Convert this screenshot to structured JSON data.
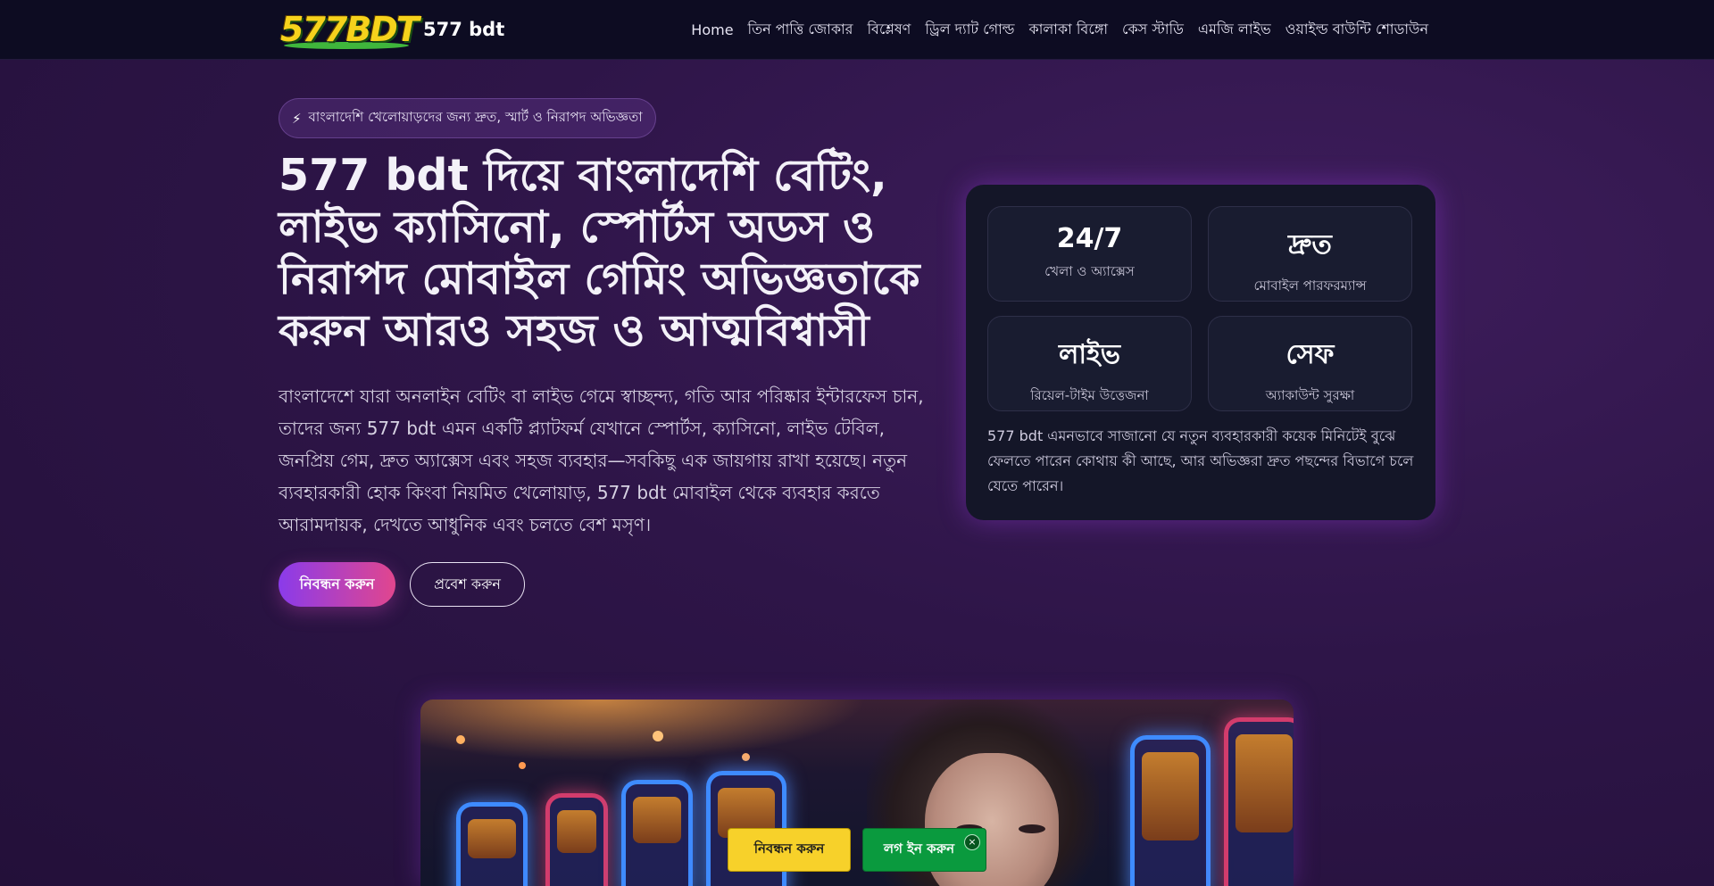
{
  "header": {
    "logo_text": "577BDT",
    "brand_name": "577 bdt",
    "nav": [
      "Home",
      "তিন পাত্তি জোকার",
      "বিশ্লেষণ",
      "ড্রিল দ্যাট গোল্ড",
      "কালাকা বিঙ্গো",
      "কেস স্টাডি",
      "এমজি লাইভ",
      "ওয়াইল্ড বাউন্টি শোডাউন"
    ]
  },
  "hero": {
    "badge_icon": "lightning-icon",
    "badge_text": "বাংলাদেশি খেলোয়াড়দের জন্য দ্রুত, স্মার্ট ও নিরাপদ অভিজ্ঞতা",
    "title": "577 bdt দিয়ে বাংলাদেশি বেটিং, লাইভ ক্যাসিনো, স্পোর্টস অডস ও নিরাপদ মোবাইল গেমিং অভিজ্ঞতাকে করুন আরও সহজ ও আত্মবিশ্বাসী",
    "description": "বাংলাদেশে যারা অনলাইন বেটিং বা লাইভ গেমে স্বাচ্ছন্দ্য, গতি আর পরিষ্কার ইন্টারফেস চান, তাদের জন্য 577 bdt এমন একটি প্ল্যাটফর্ম যেখানে স্পোর্টস, ক্যাসিনো, লাইভ টেবিল, জনপ্রিয় গেম, দ্রুত অ্যাক্সেস এবং সহজ ব্যবহার—সবকিছু এক জায়গায় রাখা হয়েছে। নতুন ব্যবহারকারী হোক কিংবা নিয়মিত খেলোয়াড়, 577 bdt মোবাইল থেকে ব্যবহার করতে আরামদায়ক, দেখতে আধুনিক এবং চলতে বেশ মসৃণ।",
    "register_label": "নিবন্ধন করুন",
    "login_label": "প্রবেশ করুন"
  },
  "stats": {
    "items": [
      {
        "value": "24/7",
        "label": "খেলা ও অ্যাক্সেস"
      },
      {
        "value": "দ্রুত",
        "label": "মোবাইল পারফরম্যান্স"
      },
      {
        "value": "লাইভ",
        "label": "রিয়েল-টাইম উত্তেজনা"
      },
      {
        "value": "সেফ",
        "label": "অ্যাকাউন্ট সুরক্ষা"
      }
    ],
    "note": "577 bdt এমনভাবে সাজানো যে নতুন ব্যবহারকারী কয়েক মিনিটেই বুঝে ফেলতে পারেন কোথায় কী আছে, আর অভিজ্ঞরা দ্রুত পছন্দের বিভাগে চলে যেতে পারেন।"
  },
  "floating_bar": {
    "register_label": "নিবন্ধন করুন",
    "login_label": "লগ ইন করুন",
    "close_symbol": "×"
  },
  "colors": {
    "accent_gradient_start": "#8a3bea",
    "accent_gradient_end": "#e1468e",
    "register_yellow": "#f7d12a",
    "login_green": "#0a9a3e"
  }
}
